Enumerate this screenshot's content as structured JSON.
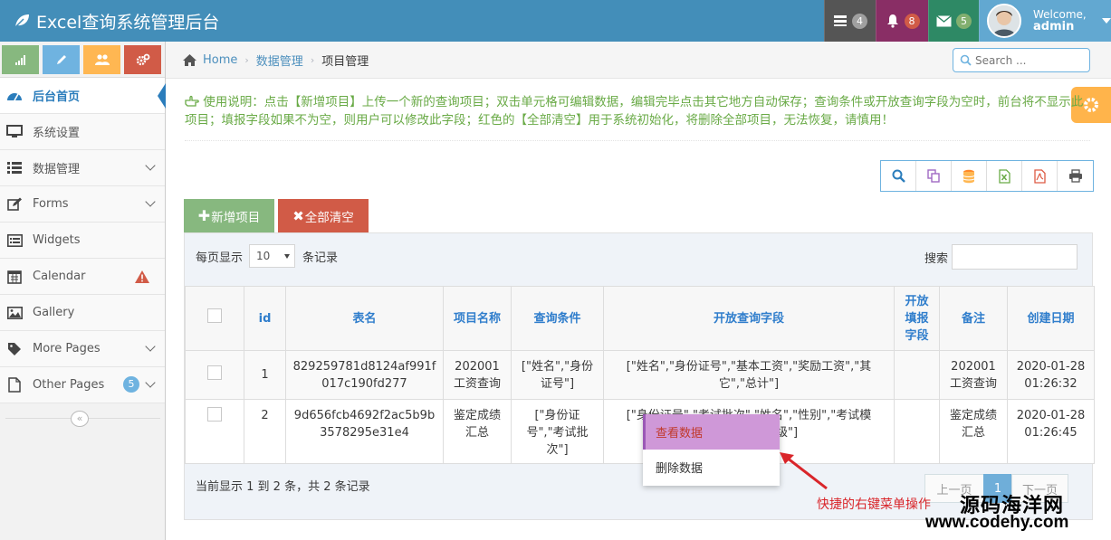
{
  "app": {
    "title": "Excel查询系统管理后台"
  },
  "navbar": {
    "tasks_count": "4",
    "notifications_count": "8",
    "messages_count": "5",
    "welcome": "Welcome,",
    "username": "admin"
  },
  "sidebar": {
    "items": [
      {
        "label": "后台首页",
        "icon": "dashboard-icon"
      },
      {
        "label": "系统设置",
        "icon": "desktop-icon"
      },
      {
        "label": "数据管理",
        "icon": "list-icon"
      },
      {
        "label": "Forms",
        "icon": "pencil-square-icon"
      },
      {
        "label": "Widgets",
        "icon": "list-alt-icon"
      },
      {
        "label": "Calendar",
        "icon": "calendar-icon"
      },
      {
        "label": "Gallery",
        "icon": "picture-icon"
      },
      {
        "label": "More Pages",
        "icon": "tag-icon"
      },
      {
        "label": "Other Pages",
        "icon": "file-icon"
      }
    ],
    "other_pages_badge": "5",
    "collapse_glyph": "«"
  },
  "breadcrumbs": {
    "home": "Home",
    "level1": "数据管理",
    "current": "项目管理",
    "sep": "›"
  },
  "search": {
    "placeholder": "Search ..."
  },
  "instructions": "使用说明：点击【新增项目】上传一个新的查询项目；双击单元格可编辑数据，编辑完毕点击其它地方自动保存；查询条件或开放查询字段为空时，前台将不显示此项目；填报字段如果不为空，则用户可以修改此字段；红色的【全部清空】用于系统初始化，将删除全部项目，无法恢复，请慎用！",
  "buttons": {
    "add": "新增项目",
    "clear": "全部清空"
  },
  "table_controls": {
    "length_prefix": "每页显示",
    "length_value": "10",
    "length_suffix": "条记录",
    "filter_label": "搜索"
  },
  "table": {
    "headers": [
      "id",
      "表名",
      "项目名称",
      "查询条件",
      "开放查询字段",
      "开放填报字段",
      "备注",
      "创建日期"
    ],
    "rows": [
      {
        "id": "1",
        "table_name": "829259781d8124af991f017c190fd277",
        "project": "202001工资查询",
        "conditions": "[\"姓名\",\"身份证号\"]",
        "open_fields": "[\"姓名\",\"身份证号\",\"基本工资\",\"奖励工资\",\"其它\",\"总计\"]",
        "fill_fields": "",
        "remark": "202001工资查询",
        "created": "2020-01-28 01:26:32"
      },
      {
        "id": "2",
        "table_name": "9d656fcb4692f2ac5b9b3578295e31e4",
        "project": "鉴定成绩汇总",
        "conditions": "[\"身份证号\",\"考试批次\"]",
        "open_fields": "[\"身份证号\",\"考试批次\",\"姓名\",\"性别\",\"考试模块\",\"级别\",\"等级\"]",
        "fill_fields": "",
        "remark": "鉴定成绩汇总",
        "created": "2020-01-28 01:26:45"
      }
    ]
  },
  "footer": {
    "info": "当前显示 1 到 2 条，共 2 条记录",
    "prev": "上一页",
    "page": "1",
    "next": "下一页"
  },
  "context_menu": {
    "view": "查看数据",
    "delete": "删除数据"
  },
  "annotation": "快捷的右键菜单操作",
  "watermark": {
    "line1": "源码海洋网",
    "line2": "www.codehy.com"
  },
  "colors": {
    "navbar": "#438eb9",
    "add_button": "#87b87f",
    "clear_button": "#d15b47",
    "highlight": "#cf98d8"
  }
}
